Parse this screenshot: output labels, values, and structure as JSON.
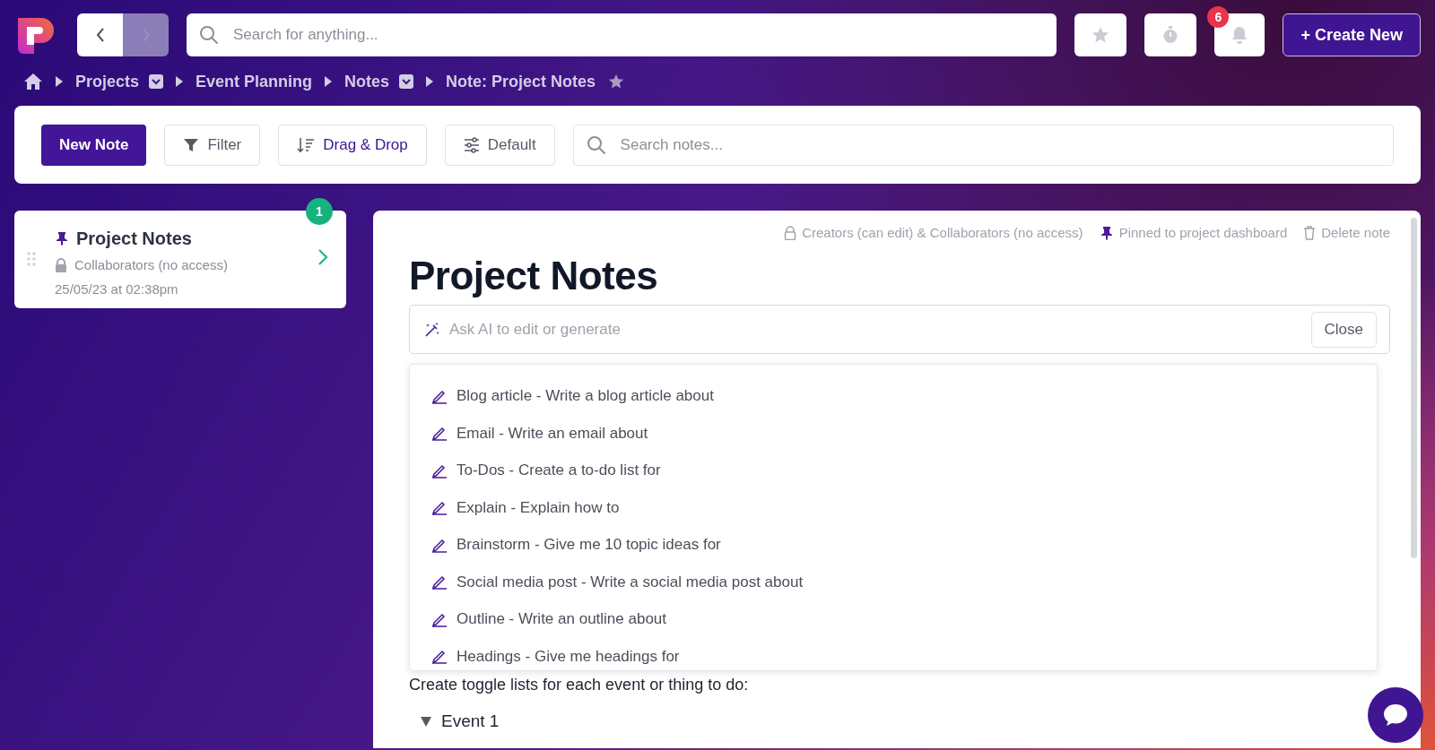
{
  "nav": {
    "back": {
      "disabled": false
    },
    "forward": {
      "disabled": true
    },
    "search_placeholder": "Search for anything...",
    "notification_count": "6",
    "create_button": "+ Create New"
  },
  "breadcrumbs": [
    {
      "label": "Projects",
      "dropdown": true
    },
    {
      "label": "Event Planning",
      "dropdown": false
    },
    {
      "label": "Notes",
      "dropdown": true
    },
    {
      "label": "Note: Project Notes",
      "dropdown": false
    }
  ],
  "toolbar": {
    "new_button": "New Note",
    "filter_button": "Filter",
    "sort_button": "Drag & Drop",
    "view_button": "Default",
    "search_placeholder": "Search notes..."
  },
  "note_list": [
    {
      "title": "Project Notes",
      "pinned": true,
      "access": "Collaborators (no access)",
      "date": "25/05/23 at 02:38pm",
      "badge": "1"
    }
  ],
  "note": {
    "permissions": "Creators (can edit) & Collaborators (no access)",
    "pinned_label": "Pinned to project dashboard",
    "delete_label": "Delete note",
    "title": "Project Notes",
    "ai_placeholder": "Ask AI to edit or generate",
    "close_button": "Close",
    "ai_suggestions": [
      "Blog article - Write a blog article about",
      "Email - Write an email about",
      "To-Dos - Create a to-do list for",
      "Explain - Explain how to",
      "Brainstorm - Give me 10 topic ideas for",
      "Social media post - Write a social media post about",
      "Outline - Write an outline about",
      "Headings - Give me headings for"
    ],
    "body_text": "Create toggle lists for each event or thing to do:",
    "toggles": [
      {
        "label": "Event 1",
        "expanded": true
      }
    ]
  }
}
